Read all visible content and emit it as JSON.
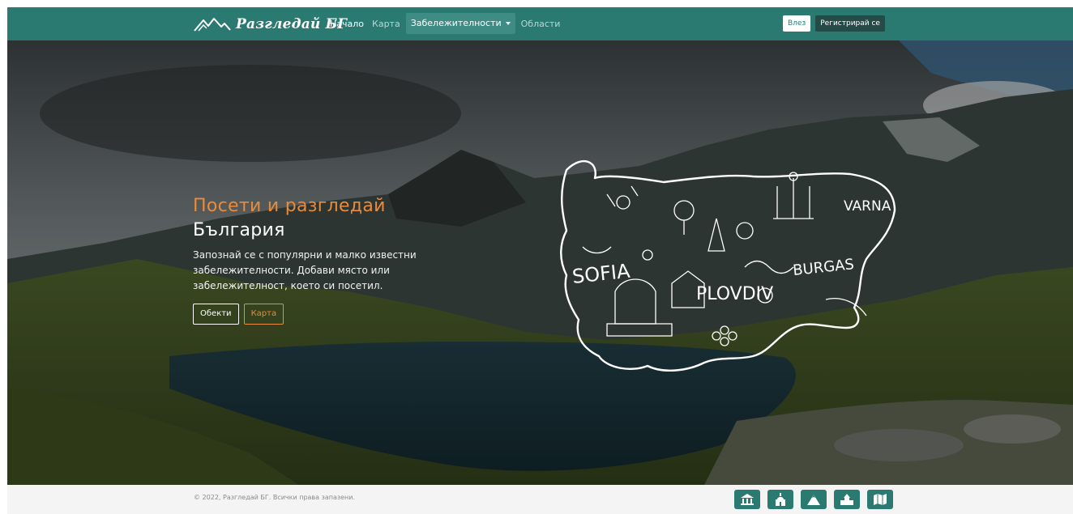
{
  "brand": {
    "name": "Разгледай БГ"
  },
  "nav": {
    "home": "Начало",
    "map": "Карта",
    "sights": "Забележителности",
    "regions": "Области"
  },
  "auth": {
    "login": "Влез",
    "register": "Регистрирай се"
  },
  "hero": {
    "title_accent": "Посети и разгледай",
    "title": "България",
    "description": "Запознай се с популярни и малко известни забележителности. Добави място или забележителност, което си посетил.",
    "btn_objects": "Обекти",
    "btn_map": "Карта",
    "map_labels": {
      "sofia": "SOFIA",
      "plovdiv": "PLOVDIV",
      "burgas": "BURGAS",
      "varna": "VARNA"
    }
  },
  "footer": {
    "copyright": "© 2022, Разгледай БГ. Всички права запазени.",
    "icons": [
      "museum-icon",
      "church-icon",
      "mountain-icon",
      "monastery-icon",
      "map-icon"
    ]
  },
  "colors": {
    "primary": "#2a7a72",
    "accent": "#e98b3a",
    "dark_button": "#244b48"
  }
}
